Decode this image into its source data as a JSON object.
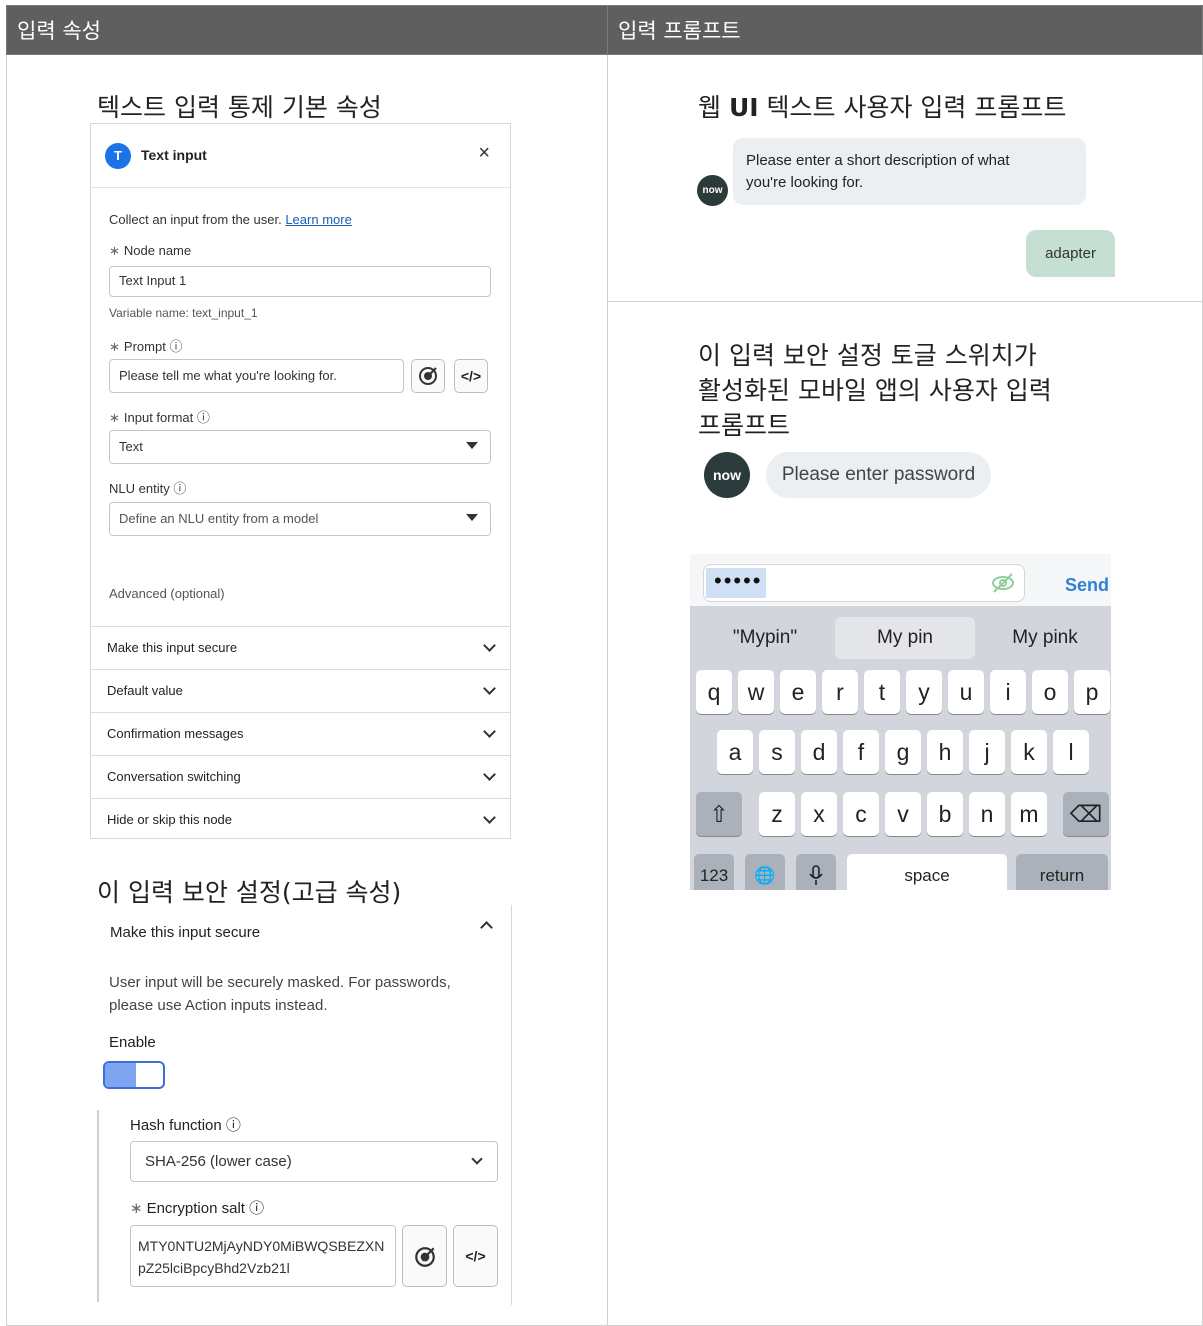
{
  "table": {
    "col1_header": "입력 속성",
    "col2_header": "입력 프롬프트"
  },
  "left": {
    "heading1": "텍스트 입력 통제 기본 속성",
    "heading2": "이 입력 보안 설정(고급 속성)"
  },
  "panel": {
    "icon_letter": "T",
    "title": "Text input",
    "close": "×",
    "intro": "Collect an input from the user.",
    "learn_more": "Learn more",
    "node_name_label": "Node name",
    "node_name_value": "Text Input 1",
    "variable_name": "Variable name: text_input_1",
    "prompt_label": "Prompt",
    "prompt_value": "Please tell me what you're looking for.",
    "code_button": "</>",
    "input_format_label": "Input format",
    "input_format_value": "Text",
    "nlu_label": "NLU entity",
    "nlu_placeholder": "Define an NLU entity from a model",
    "advanced": "Advanced (optional)",
    "info_glyph": "ⓘ",
    "star": "∗",
    "accordions": [
      "Make this input secure",
      "Default value",
      "Confirmation messages",
      "Conversation switching",
      "Hide or skip this node"
    ]
  },
  "secure": {
    "title": "Make this input secure",
    "description_line1": "User input will be securely masked. For passwords,",
    "description_line2": "please use Action inputs instead.",
    "enable_label": "Enable",
    "enabled": true,
    "hash_label": "Hash function",
    "hash_value": "SHA-256 (lower case)",
    "salt_label": "Encryption salt",
    "salt_line1": "MTY0NTU2MjAyNDY0MiBWQSBEZXN",
    "salt_line2": "pZ25lciBpcyBhd2Vzb21l",
    "code_button": "</>"
  },
  "right": {
    "heading1_pre": "웹 ",
    "heading1_bold": "UI",
    "heading1_post": " 텍스트 사용자 입력 프롬프트",
    "web_bot_message_line1": "Please enter a short description of what",
    "web_bot_message_line2": "you're looking for.",
    "web_user_reply": "adapter",
    "avatar_text": "now",
    "heading2_line1": "이 입력 보안 설정 토글 스위치가",
    "heading2_line2": "활성화된 모바일 앱의 사용자 입력",
    "heading2_line3": "프롬프트"
  },
  "mobile": {
    "avatar_text": "now",
    "bot_message": "Please enter password",
    "password_mask": "•••••",
    "send": "Send",
    "suggestions": [
      "\"Mypin\"",
      "My pin",
      "My pink"
    ],
    "row1": [
      "q",
      "w",
      "e",
      "r",
      "t",
      "y",
      "u",
      "i",
      "o",
      "p"
    ],
    "row2": [
      "a",
      "s",
      "d",
      "f",
      "g",
      "h",
      "j",
      "k",
      "l"
    ],
    "row3": [
      "z",
      "x",
      "c",
      "v",
      "b",
      "n",
      "m"
    ],
    "shift": "⇧",
    "backspace": "⌫",
    "numbers_key": "123",
    "globe": "🌐",
    "space": "space",
    "return": "return"
  }
}
